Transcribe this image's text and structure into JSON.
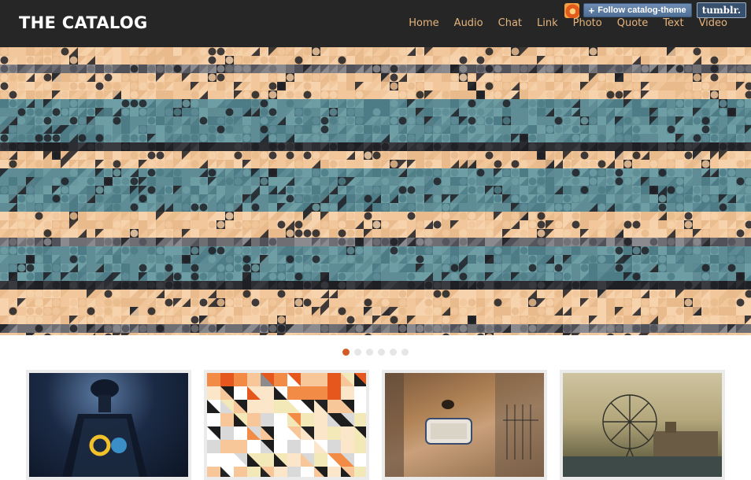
{
  "site": {
    "title": "THE CATALOG"
  },
  "nav": {
    "items": [
      "Home",
      "Audio",
      "Chat",
      "Link",
      "Photo",
      "Quote",
      "Text",
      "Video"
    ]
  },
  "tumblr": {
    "follow_label": "Follow catalog-theme",
    "logo_label": "tumblr."
  },
  "slider": {
    "total_slides": 6,
    "active_index": 0
  },
  "colors": {
    "header_bg": "#262626",
    "nav_link": "#e6b47c",
    "accent": "#d25b26",
    "hero_peach": "#f1c79b",
    "hero_teal": "#5f8c95",
    "hero_gray": "#6e6e73"
  },
  "icons": {
    "plus": "plus-icon"
  },
  "cards": [
    {
      "name": "lamp-photo"
    },
    {
      "name": "mosaic-photo"
    },
    {
      "name": "wall-sign-photo"
    },
    {
      "name": "london-eye-photo"
    }
  ]
}
